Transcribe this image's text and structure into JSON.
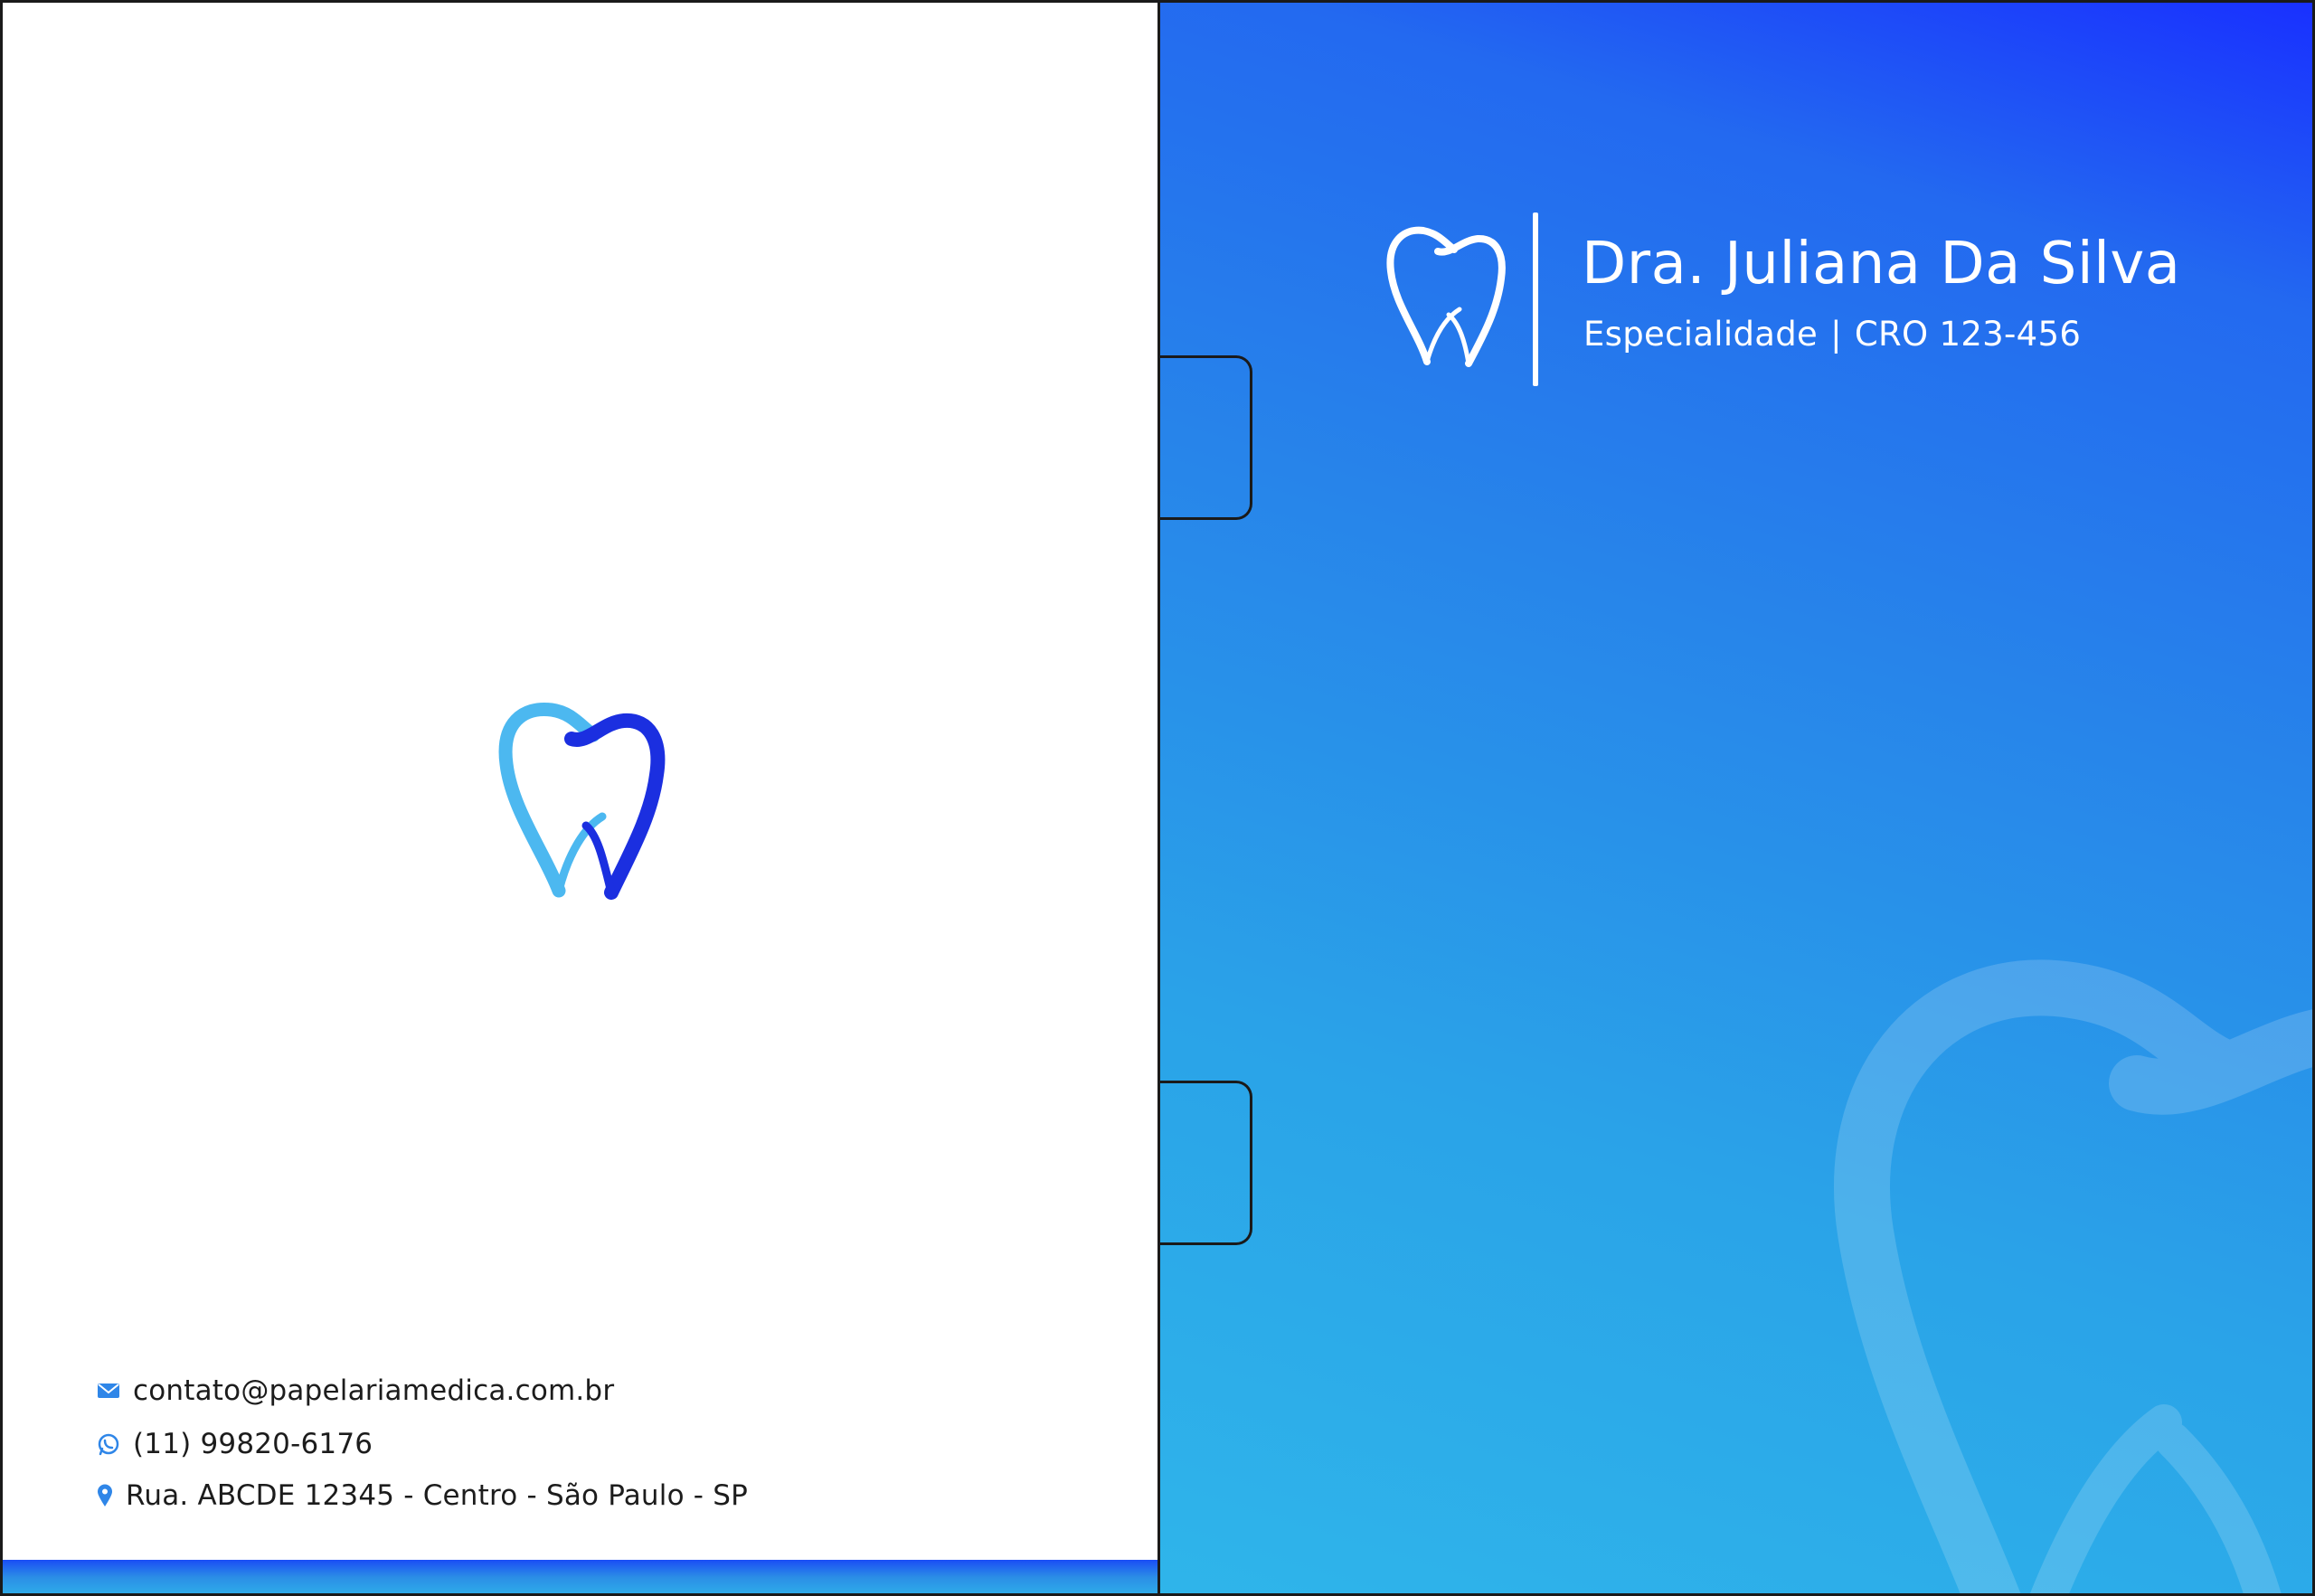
{
  "back_panel": {
    "contact": {
      "email": "contato@papelariamedica.com.br",
      "phone": "(11) 99820-6176",
      "address": "Rua. ABCDE 12345 - Centro - São Paulo - SP"
    },
    "icons": {
      "email": "envelope-icon",
      "phone": "whatsapp-icon",
      "address": "location-pin-icon",
      "logo": "tooth-logo-icon"
    }
  },
  "front_panel": {
    "name": "Dra. Juliana Da Silva",
    "specialty": "Especialidade",
    "separator": "|",
    "registration": "CRO 123-456",
    "icons": {
      "logo": "tooth-logo-icon",
      "watermark": "tooth-watermark-icon"
    }
  },
  "colors": {
    "accent_dark": "#1930ff",
    "accent_mid": "#2784ea",
    "accent_light": "#2fb5ea",
    "logo_light": "#4cb8f0",
    "logo_dark": "#1b2fe0",
    "text_dark": "#1c1c1c",
    "outline": "#1a1a1a"
  }
}
